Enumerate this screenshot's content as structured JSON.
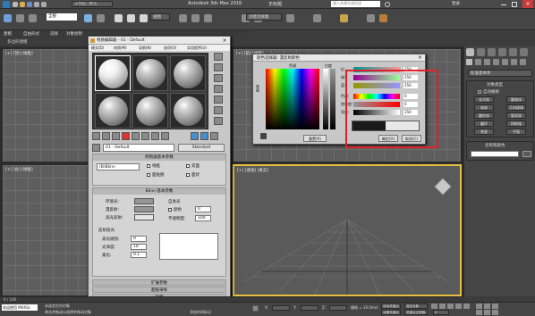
{
  "titlebar": {
    "workspace_label": "工作区: 默认",
    "app_title": "Autodesk 3ds Max 2016",
    "file_title": "无标题",
    "search_placeholder": "键入关键字或短语",
    "login_label": "登录"
  },
  "toolbar": {
    "selection_filter": "全部",
    "view_dropdown": "视图",
    "named_selection": "创建选择集"
  },
  "ribbon": {
    "tab_modeling": "建模",
    "tab_freeform": "自由形式",
    "tab_selection": "选择",
    "tab_object_paint": "对象绘制",
    "polygon_label": "多边形建模"
  },
  "viewports": {
    "top_left_label": "[+] [顶] [线框]",
    "top_right_label": "[+] [前] [线框]",
    "bottom_left_label": "[+] [左] [线框]",
    "bottom_right_label": "[+] [透视] [真实]"
  },
  "material_editor": {
    "title": "材质编辑器 - 01 - Default",
    "menu": [
      "模式(D)",
      "材质(M)",
      "导航(N)",
      "选项(O)",
      "实用程序(U)"
    ],
    "material_name": "01 - Default",
    "material_type": "Standard",
    "shader_rollout": "明暗器基本参数",
    "shader_type": "(B)Blinn",
    "cb_wire": "线框",
    "cb_twosided": "双面",
    "cb_facemap": "面贴图",
    "cb_faceted": "面状",
    "blinn_rollout": "Blinn 基本参数",
    "ambient": "环境光:",
    "diffuse": "漫反射:",
    "specular": "高光反射:",
    "self_illum": "自发光",
    "color_label": "颜色",
    "color_value": "0",
    "opacity": "不透明度:",
    "opacity_value": "100",
    "specular_highlights": "反射高光",
    "spec_level": "高光级别:",
    "spec_level_value": "0",
    "glossiness": "光泽度:",
    "glossiness_value": "10",
    "soften": "柔化:",
    "soften_value": "0.1",
    "rollout_extended": "扩展参数",
    "rollout_supersampling": "超级采样",
    "rollout_maps": "贴图",
    "object_label": "Default"
  },
  "color_selector": {
    "title": "颜色选择器: 漫反射颜色",
    "hue_label": "色调",
    "whiteness_label": "白度",
    "blackness_label": "黑度",
    "red": "红:",
    "green": "绿:",
    "blue": "蓝:",
    "hue": "色调:",
    "saturation": "饱和度:",
    "value": "亮度:",
    "red_val": "150",
    "green_val": "150",
    "blue_val": "150",
    "hue_val": "0",
    "sat_val": "0",
    "val_val": "150",
    "reset_btn": "重置(R)",
    "ok_btn": "确定(O)",
    "cancel_btn": "取消(C)"
  },
  "command_panel": {
    "dropdown": "标准基本体",
    "object_type_title": "对象类型",
    "autogrid": "自动栅格",
    "buttons": [
      "长方体",
      "圆锥体",
      "球体",
      "几何球体",
      "圆柱体",
      "管状体",
      "圆环",
      "四棱锥",
      "茶壶",
      "平面"
    ],
    "name_color_title": "名称和颜色"
  },
  "statusbar": {
    "selection": "未选定任何对象",
    "hint": "单击并拖动以选择并移动对象",
    "grid": "栅格 = 10.0mm",
    "x": "X:",
    "y": "Y:",
    "z": "Z:",
    "auto_key": "自动关键点",
    "set_key": "设置关键点",
    "selected": "选定对象",
    "key_filters": "关键点过滤器...",
    "add_time_tag": "添加时间标记",
    "welcome": "欢迎使用 MAXSc",
    "frame": "0 / 100",
    "frame_input": "0"
  },
  "colors": {
    "accent_red": "#e0202a",
    "swatch_gray": "#969696"
  }
}
